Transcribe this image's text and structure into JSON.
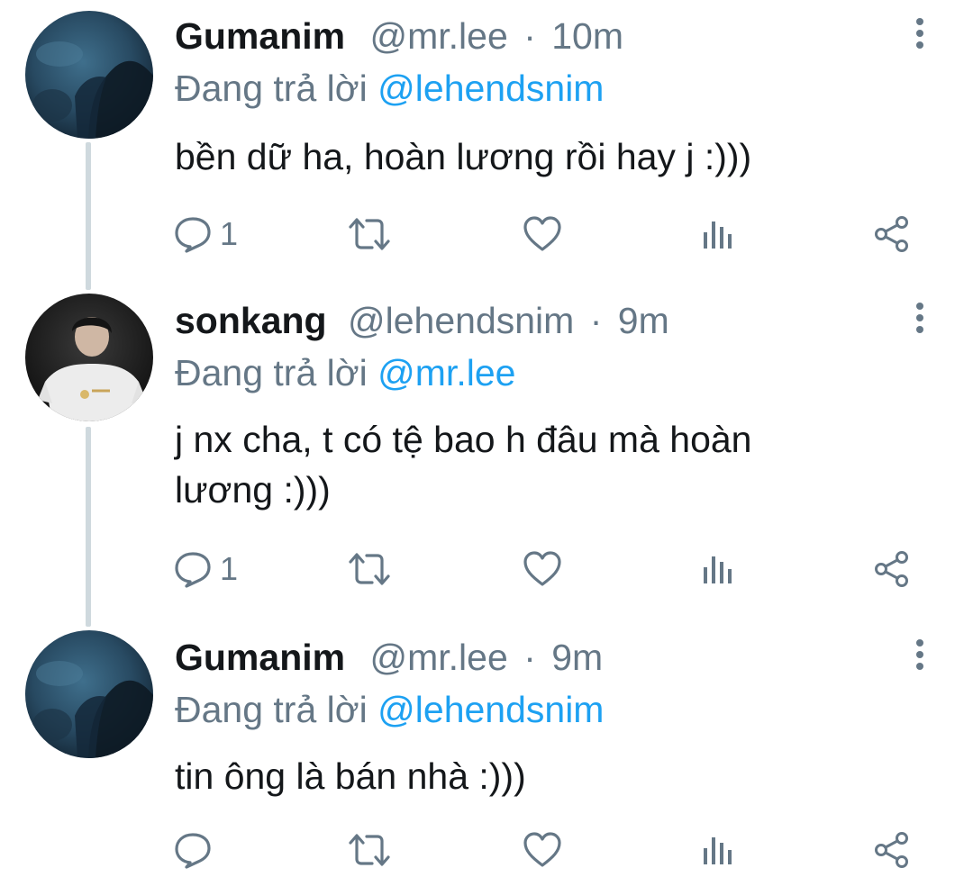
{
  "colors": {
    "text": "#14171a",
    "secondary": "#657786",
    "mention": "#1da1f2",
    "thread_line": "#cfd9de"
  },
  "tweets": [
    {
      "name": "Gumanim",
      "handle": "@mr.lee",
      "separator": "·",
      "time": "10m",
      "reply_prefix": "Đang trả lời",
      "reply_to": "@lehendsnim",
      "text": "bền dữ ha, hoàn lương rồi hay j :)))",
      "reply_count": "1",
      "avatar": "dark-blue-avatar"
    },
    {
      "name": "sonkang",
      "handle": "@lehendsnim",
      "separator": "·",
      "time": "9m",
      "reply_prefix": "Đang trả lời",
      "reply_to": "@mr.lee",
      "text": "j nx cha, t có tệ bao h đâu mà hoàn lương :)))",
      "reply_count": "1",
      "avatar": "person-white-shirt-avatar"
    },
    {
      "name": "Gumanim",
      "handle": "@mr.lee",
      "separator": "·",
      "time": "9m",
      "reply_prefix": "Đang trả lời",
      "reply_to": "@lehendsnim",
      "text": "tin ông là bán nhà :)))",
      "reply_count": "",
      "avatar": "dark-blue-avatar"
    }
  ]
}
